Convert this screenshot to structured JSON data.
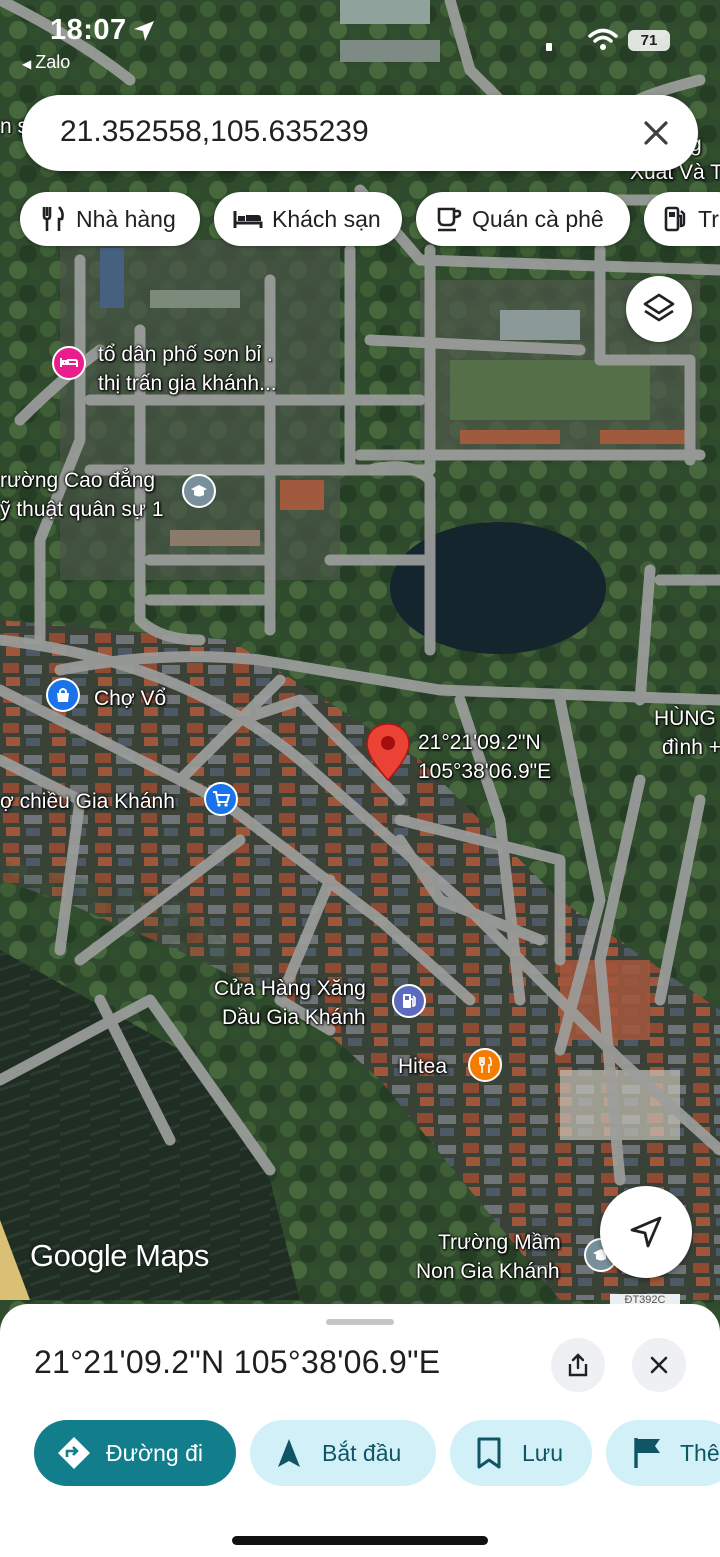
{
  "status_bar": {
    "time": "18:07",
    "back_app": "Zalo",
    "battery": "71"
  },
  "search": {
    "query": "21.352558,105.635239"
  },
  "chips": [
    {
      "label": "Nhà hàng",
      "icon": "fork-knife-icon"
    },
    {
      "label": "Khách sạn",
      "icon": "bed-icon"
    },
    {
      "label": "Quán cà phê",
      "icon": "coffee-cup-icon"
    },
    {
      "label": "Tr",
      "icon": "gas-station-icon"
    }
  ],
  "map": {
    "labels": {
      "to_dan_pho_line1": "tổ dân phố sơn bỉ .",
      "to_dan_pho_line2": "thị trấn gia khánh...",
      "truong_cd_line1": "rường Cao đẳng",
      "truong_cd_line2": "ỹ thuật quân sự 1",
      "cho_vo": "Chợ Vổ",
      "cho_chieu": "ợ chiều Gia Khánh",
      "pin_lat": "21°21'09.2\"N",
      "pin_lng": "105°38'06.9\"E",
      "hung_line1": "HÙNG",
      "hung_line2": "đình +",
      "cua_hang_line1": "Cửa Hàng Xăng",
      "cua_hang_line2": "Dầu Gia Khánh",
      "hitea": "Hitea",
      "truong_mam_line1": "Trường Mầm",
      "truong_mam_line2": "Non Gia Khánh",
      "top_right_line1": "g",
      "top_right_line2": "Xuất Và T",
      "top_left_cut": "n s"
    },
    "logo": "Google Maps",
    "road_badge": "ĐT392C"
  },
  "sheet": {
    "title": "21°21'09.2\"N 105°38'06.9\"E",
    "actions": [
      {
        "label": "Đường đi",
        "icon": "directions-icon"
      },
      {
        "label": "Bắt đầu",
        "icon": "navigation-arrow-icon"
      },
      {
        "label": "Lưu",
        "icon": "bookmark-icon"
      },
      {
        "label": "Thê",
        "icon": "flag-icon"
      }
    ]
  },
  "colors": {
    "accent": "#127e8c",
    "light_button": "#d2f0f7",
    "red_pin": "#ea4335",
    "hotel_pin": "#e91e8c",
    "blue_pin": "#1a73e8",
    "gray_pin": "#78909c",
    "food_pin": "#f57c00"
  }
}
